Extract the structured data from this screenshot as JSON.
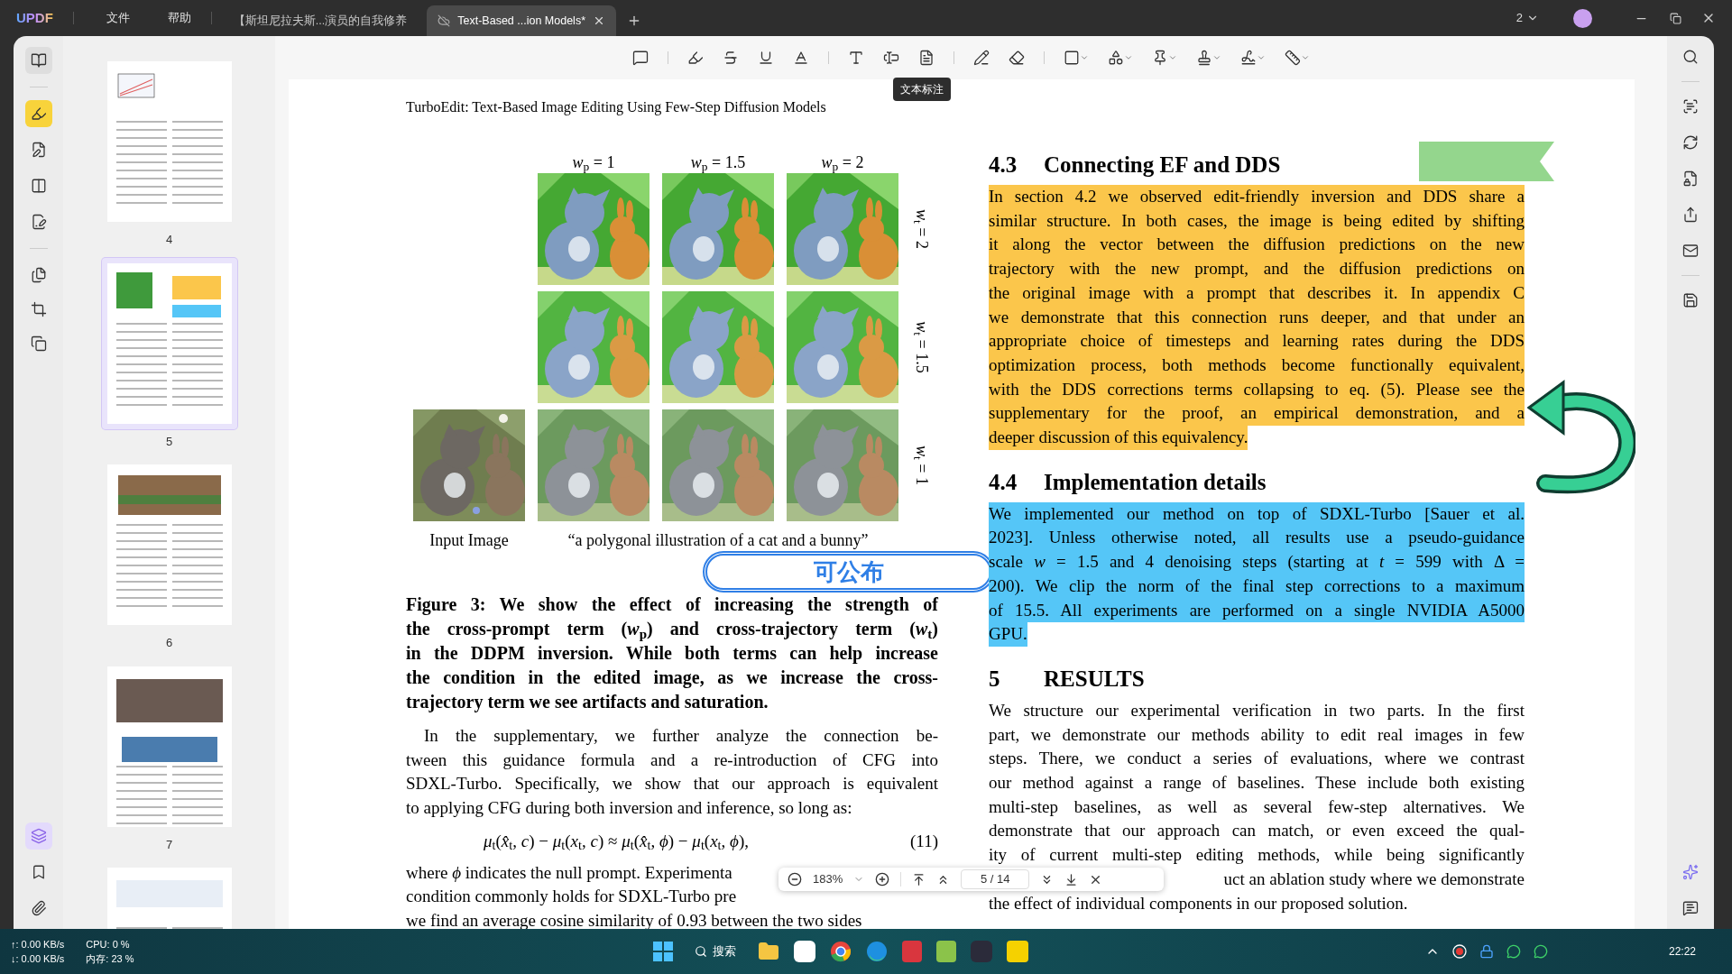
{
  "title_bar": {
    "logo": "UPDF",
    "menu": [
      "文件",
      "帮助"
    ],
    "tabs": [
      {
        "label": "【斯坦尼拉夫斯...演员的自我修养",
        "selected": false
      },
      {
        "label": "Text-Based ...ion Models*",
        "selected": true
      }
    ],
    "window_count": "2"
  },
  "toolbar": {
    "tooltip": "文本标注"
  },
  "thumbnails": [
    {
      "label": "4",
      "selected": false
    },
    {
      "label": "5",
      "selected": true
    },
    {
      "label": "6",
      "selected": false
    },
    {
      "label": "7",
      "selected": false
    },
    {
      "selected": false
    }
  ],
  "document": {
    "running_header": "TurboEdit: Text-Based Image Editing Using Few-Step Diffusion Models",
    "figure": {
      "column_labels": [
        "*w*$_{p}$ = 1",
        "*w*$_{p}$ = 1.5",
        "*w*$_{p}$ = 2"
      ],
      "row_labels": [
        "*w*$_{t}$ = 2",
        "*w*$_{t}$ = 1.5",
        "*w*$_{t}$ = 1"
      ],
      "input_label": "Input Image",
      "prompt_label": "“a polygonal illustration of a cat and a bunny”"
    },
    "caption": [
      "Figure 3: We show the effect of increasing the strength of",
      "the cross-prompt term (*w*$_{p}$) and cross-trajectory term (*w*$_{t}$)",
      "in the DDPM inversion. While both terms can help increase",
      "the condition in the edited image, as we increase the cross-",
      "trajectory term we see artifacts and saturation."
    ],
    "left_paragraph": [
      "In the supplementary, we further analyze the connection be-",
      "tween this guidance formula and a re-introduction of CFG into",
      "SDXL-Turbo. Specifically, we show that our approach is equivalent",
      "to applying CFG during both inversion and inference, so long as:"
    ],
    "equation": {
      "formula": "*μ*$_{t}$(*x̂*$_{t}$, *c*) − *μ*$_{t}$(*x*$_{t}$, *c*) ≈ *μ*$_{t}$(*x̂*$_{t}$, *ϕ*) − *μ*$_{t}$(*x*$_{t}$, *ϕ*),",
      "number": "(11)"
    },
    "left_tail": [
      "where *ϕ* indicates the null prompt. Experimenta",
      "condition commonly holds for SDXL-Turbo pre",
      "we find an average cosine similarity of 0.93 between the two sides"
    ],
    "sections": [
      {
        "number": "4.3",
        "title": "Connecting EF and DDS",
        "color": "#fbc64b",
        "lines": [
          "In section 4.2 we observed edit-friendly inversion and DDS share a",
          "similar structure. In both cases, the image is being edited by shifting",
          "it along the vector between the diffusion predictions on the new",
          "trajectory with the new prompt, and the diffusion predictions on",
          "the original image with a prompt that describes it. In appendix C",
          "we demonstrate that this connection runs deeper, and that under an",
          "appropriate choice of timesteps and learning rates during the DDS",
          "optimization process, both methods become functionally equivalent,",
          "with the DDS corrections terms collapsing to eq. (5). Please see the",
          "supplementary for the proof, an empirical demonstration, and a",
          "deeper discussion of this equivalency."
        ]
      },
      {
        "number": "4.4",
        "title": "Implementation details",
        "color": "#55c6f7",
        "lines": [
          "We implemented our method on top of SDXL-Turbo [Sauer et al.",
          "2023]. Unless otherwise noted, all results use a pseudo-guidance",
          "scale *w* = 1.5 and 4 denoising steps (starting at *t* = 599 with Δ =",
          "200). We clip the norm of the final step corrections to a maximum",
          "of 15.5. All experiments are performed on a single NVIDIA A5000",
          "GPU."
        ]
      },
      {
        "number": "5",
        "title": "RESULTS",
        "lines": [
          "We structure our experimental verification in two parts. In the first",
          "part, we demonstrate our methods ability to edit real images in few",
          "steps. There, we conduct a series of evaluations, where we contrast",
          "our method against a range of baselines. These include both existing",
          "multi-step baselines, as well as several few-step alternatives. We",
          "demonstrate that our approach can match, or even exceed the qual-",
          "ity of current multi-step editing methods, while being significantly"
        ],
        "covered_line": "uct an ablation study where we demonstrate",
        "end_line": "the effect of individual components in our proposed solution."
      }
    ]
  },
  "stamp": "可公布",
  "zoom_bar": {
    "zoom": "183%",
    "page_field": "5 / 14"
  },
  "taskbar": {
    "net_up": "↑: 0.00 KB/s",
    "net_down": "↓: 0.00 KB/s",
    "cpu": "CPU: 0 %",
    "memory": "内存: 23 %",
    "search": "搜索",
    "clock": "22:22"
  }
}
